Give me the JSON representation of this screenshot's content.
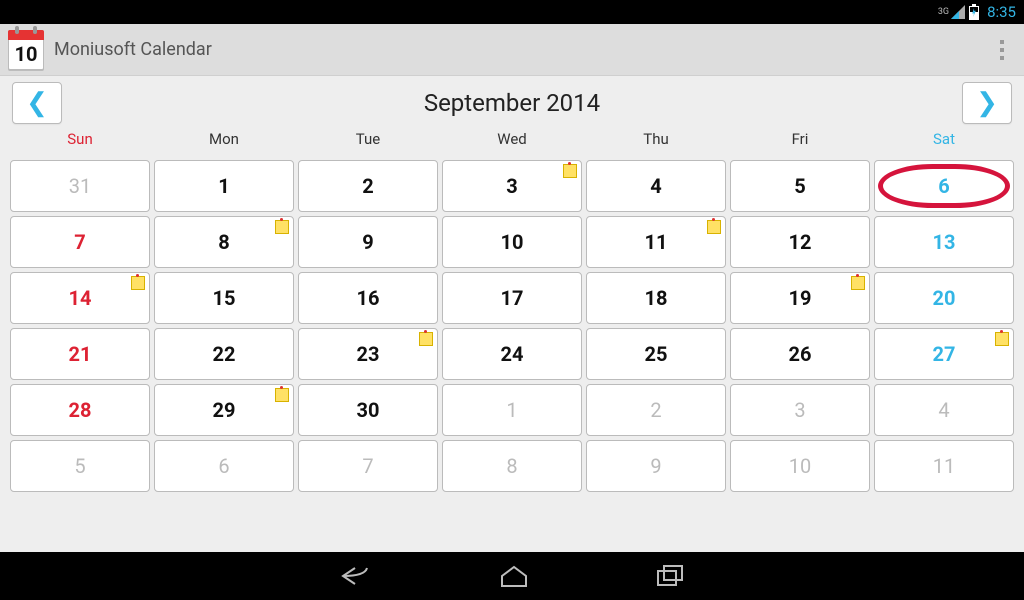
{
  "status": {
    "network": "3G",
    "time": "8:35"
  },
  "app": {
    "icon_day": "10",
    "title": "Moniusoft Calendar",
    "month_title": "September 2014",
    "weekdays": [
      "Sun",
      "Mon",
      "Tue",
      "Wed",
      "Thu",
      "Fri",
      "Sat"
    ],
    "cells": [
      {
        "d": "31",
        "cls": "other"
      },
      {
        "d": "1"
      },
      {
        "d": "2"
      },
      {
        "d": "3",
        "note": true
      },
      {
        "d": "4"
      },
      {
        "d": "5"
      },
      {
        "d": "6",
        "cls": "sat",
        "today": true
      },
      {
        "d": "7",
        "cls": "sun"
      },
      {
        "d": "8",
        "note": true
      },
      {
        "d": "9"
      },
      {
        "d": "10"
      },
      {
        "d": "11",
        "note": true
      },
      {
        "d": "12"
      },
      {
        "d": "13",
        "cls": "sat"
      },
      {
        "d": "14",
        "cls": "sun",
        "note": true
      },
      {
        "d": "15"
      },
      {
        "d": "16"
      },
      {
        "d": "17"
      },
      {
        "d": "18"
      },
      {
        "d": "19",
        "note": true
      },
      {
        "d": "20",
        "cls": "sat"
      },
      {
        "d": "21",
        "cls": "sun"
      },
      {
        "d": "22"
      },
      {
        "d": "23",
        "note": true
      },
      {
        "d": "24"
      },
      {
        "d": "25"
      },
      {
        "d": "26"
      },
      {
        "d": "27",
        "cls": "sat",
        "note": true
      },
      {
        "d": "28",
        "cls": "sun"
      },
      {
        "d": "29",
        "note": true
      },
      {
        "d": "30"
      },
      {
        "d": "1",
        "cls": "other"
      },
      {
        "d": "2",
        "cls": "other"
      },
      {
        "d": "3",
        "cls": "other"
      },
      {
        "d": "4",
        "cls": "other"
      },
      {
        "d": "5",
        "cls": "other"
      },
      {
        "d": "6",
        "cls": "other"
      },
      {
        "d": "7",
        "cls": "other"
      },
      {
        "d": "8",
        "cls": "other"
      },
      {
        "d": "9",
        "cls": "other"
      },
      {
        "d": "10",
        "cls": "other"
      },
      {
        "d": "11",
        "cls": "other"
      }
    ]
  }
}
